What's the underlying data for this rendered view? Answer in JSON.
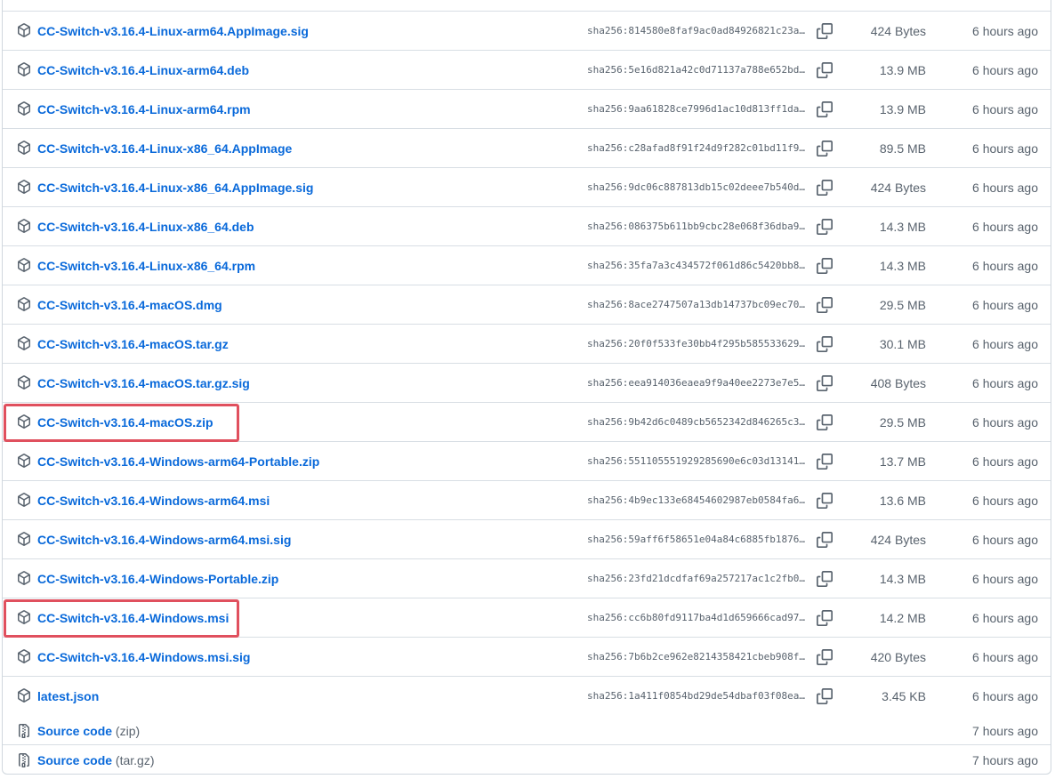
{
  "assets": [
    {
      "name": "CC-Switch-v3.16.4-Linux-arm64.AppImage.sig",
      "hash": "sha256:814580e8faf9ac0ad84926821c23a…",
      "size": "424 Bytes",
      "time": "6 hours ago",
      "icon": "package-icon"
    },
    {
      "name": "CC-Switch-v3.16.4-Linux-arm64.deb",
      "hash": "sha256:5e16d821a42c0d71137a788e652bd…",
      "size": "13.9 MB",
      "time": "6 hours ago",
      "icon": "package-icon"
    },
    {
      "name": "CC-Switch-v3.16.4-Linux-arm64.rpm",
      "hash": "sha256:9aa61828ce7996d1ac10d813ff1da…",
      "size": "13.9 MB",
      "time": "6 hours ago",
      "icon": "package-icon"
    },
    {
      "name": "CC-Switch-v3.16.4-Linux-x86_64.AppImage",
      "hash": "sha256:c28afad8f91f24d9f282c01bd11f9…",
      "size": "89.5 MB",
      "time": "6 hours ago",
      "icon": "package-icon"
    },
    {
      "name": "CC-Switch-v3.16.4-Linux-x86_64.AppImage.sig",
      "hash": "sha256:9dc06c887813db15c02deee7b540d…",
      "size": "424 Bytes",
      "time": "6 hours ago",
      "icon": "package-icon"
    },
    {
      "name": "CC-Switch-v3.16.4-Linux-x86_64.deb",
      "hash": "sha256:086375b611bb9cbc28e068f36dba9…",
      "size": "14.3 MB",
      "time": "6 hours ago",
      "icon": "package-icon"
    },
    {
      "name": "CC-Switch-v3.16.4-Linux-x86_64.rpm",
      "hash": "sha256:35fa7a3c434572f061d86c5420bb8…",
      "size": "14.3 MB",
      "time": "6 hours ago",
      "icon": "package-icon"
    },
    {
      "name": "CC-Switch-v3.16.4-macOS.dmg",
      "hash": "sha256:8ace2747507a13db14737bc09ec70…",
      "size": "29.5 MB",
      "time": "6 hours ago",
      "icon": "package-icon"
    },
    {
      "name": "CC-Switch-v3.16.4-macOS.tar.gz",
      "hash": "sha256:20f0f533fe30bb4f295b585533629…",
      "size": "30.1 MB",
      "time": "6 hours ago",
      "icon": "package-icon"
    },
    {
      "name": "CC-Switch-v3.16.4-macOS.tar.gz.sig",
      "hash": "sha256:eea914036eaea9f9a40ee2273e7e5…",
      "size": "408 Bytes",
      "time": "6 hours ago",
      "icon": "package-icon"
    },
    {
      "name": "CC-Switch-v3.16.4-macOS.zip",
      "hash": "sha256:9b42d6c0489cb5652342d846265c3…",
      "size": "29.5 MB",
      "time": "6 hours ago",
      "icon": "package-icon"
    },
    {
      "name": "CC-Switch-v3.16.4-Windows-arm64-Portable.zip",
      "hash": "sha256:551105551929285690e6c03d13141…",
      "size": "13.7 MB",
      "time": "6 hours ago",
      "icon": "package-icon"
    },
    {
      "name": "CC-Switch-v3.16.4-Windows-arm64.msi",
      "hash": "sha256:4b9ec133e68454602987eb0584fa6…",
      "size": "13.6 MB",
      "time": "6 hours ago",
      "icon": "package-icon"
    },
    {
      "name": "CC-Switch-v3.16.4-Windows-arm64.msi.sig",
      "hash": "sha256:59aff6f58651e04a84c6885fb1876…",
      "size": "424 Bytes",
      "time": "6 hours ago",
      "icon": "package-icon"
    },
    {
      "name": "CC-Switch-v3.16.4-Windows-Portable.zip",
      "hash": "sha256:23fd21dcdfaf69a257217ac1c2fb0…",
      "size": "14.3 MB",
      "time": "6 hours ago",
      "icon": "package-icon"
    },
    {
      "name": "CC-Switch-v3.16.4-Windows.msi",
      "hash": "sha256:cc6b80fd9117ba4d1d659666cad97…",
      "size": "14.2 MB",
      "time": "6 hours ago",
      "icon": "package-icon"
    },
    {
      "name": "CC-Switch-v3.16.4-Windows.msi.sig",
      "hash": "sha256:7b6b2ce962e8214358421cbeb908f…",
      "size": "420 Bytes",
      "time": "6 hours ago",
      "icon": "package-icon"
    },
    {
      "name": "latest.json",
      "hash": "sha256:1a411f0854bd29de54dbaf03f08ea…",
      "size": "3.45 KB",
      "time": "6 hours ago",
      "icon": "package-icon"
    }
  ],
  "source_code": [
    {
      "label": "Source code",
      "format": "(zip)",
      "time": "7 hours ago",
      "icon": "file-zip-icon"
    },
    {
      "label": "Source code",
      "format": "(tar.gz)",
      "time": "7 hours ago",
      "icon": "file-zip-icon"
    }
  ],
  "highlighted_assets": [
    "CC-Switch-v3.16.4-macOS.zip",
    "CC-Switch-v3.16.4-Windows.msi"
  ],
  "colors": {
    "link": "#0969da",
    "muted": "#59636e",
    "border": "#d8dee4",
    "highlight": "#e0505e"
  }
}
